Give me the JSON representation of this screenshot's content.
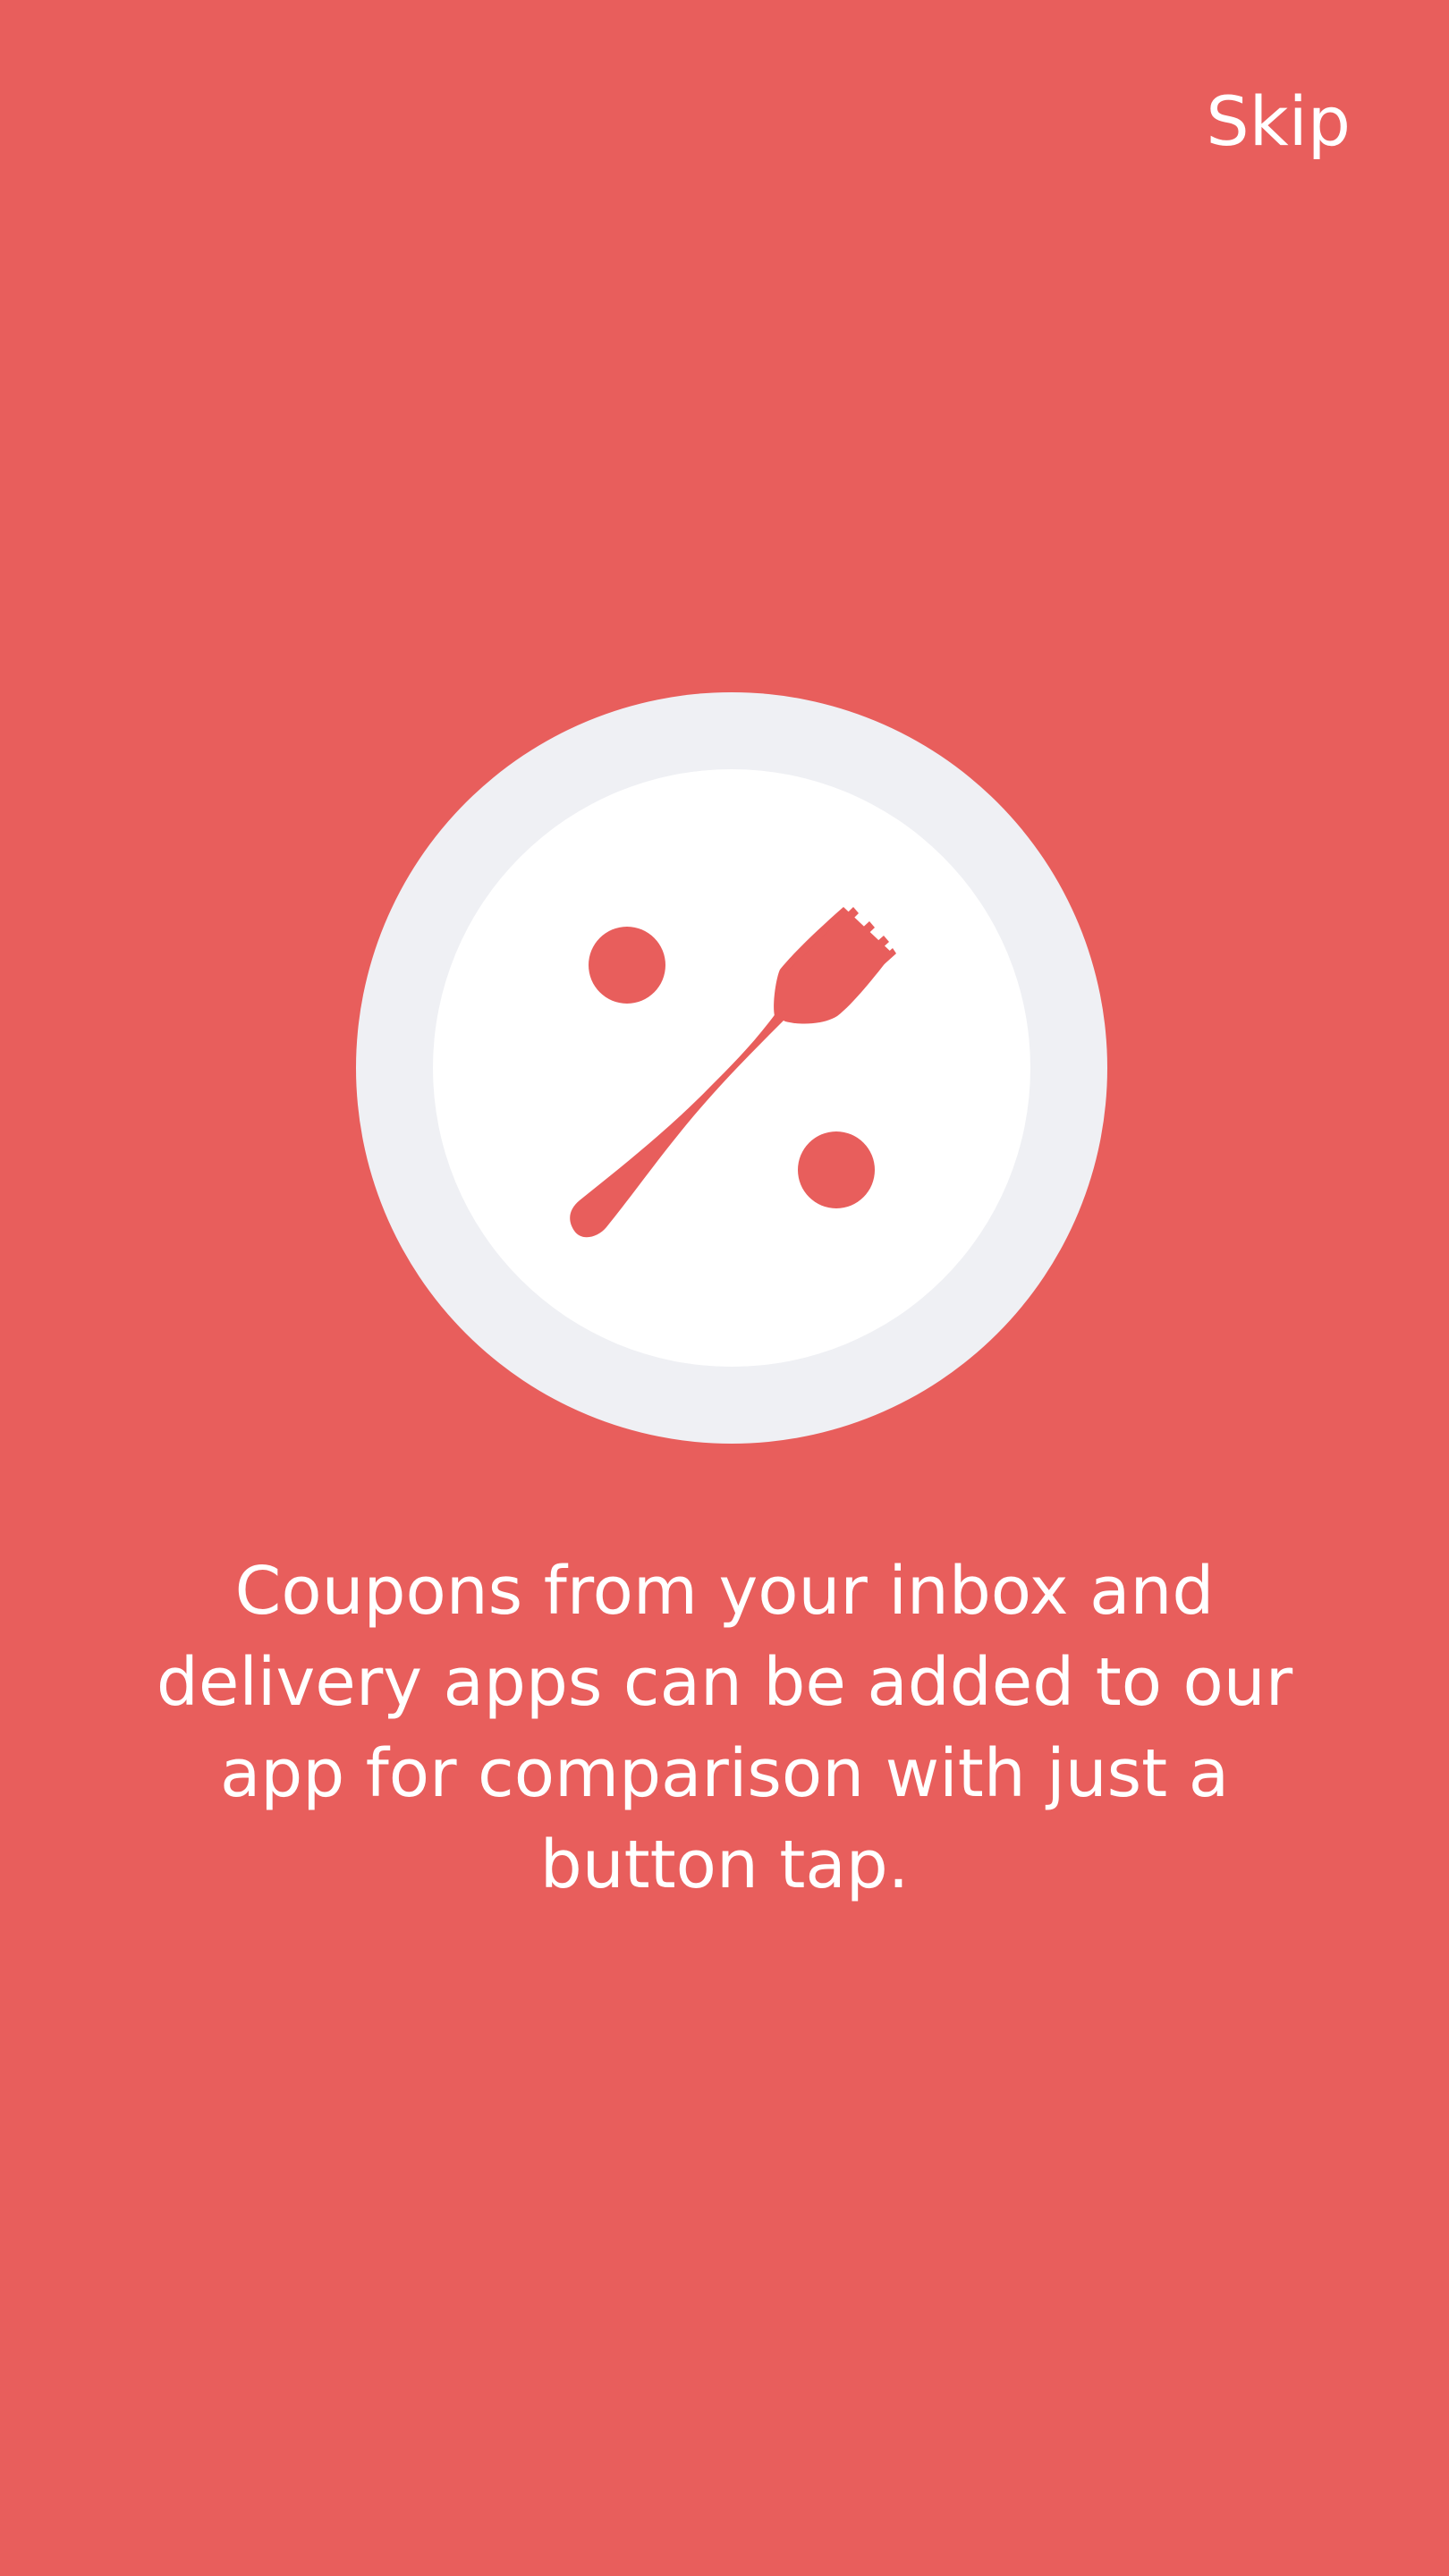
{
  "header": {
    "skip_label": "Skip"
  },
  "illustration": {
    "icon": "fork-percent-icon",
    "plate_outer_color": "#EFF0F4",
    "plate_inner_color": "#FFFFFF",
    "accent_color": "#E85E5C"
  },
  "onboarding": {
    "message": "Coupons from your inbox and delivery apps can be added to our app for comparison with just a button tap."
  },
  "theme": {
    "background": "#E85E5C",
    "text_color": "#FFFFFF"
  }
}
